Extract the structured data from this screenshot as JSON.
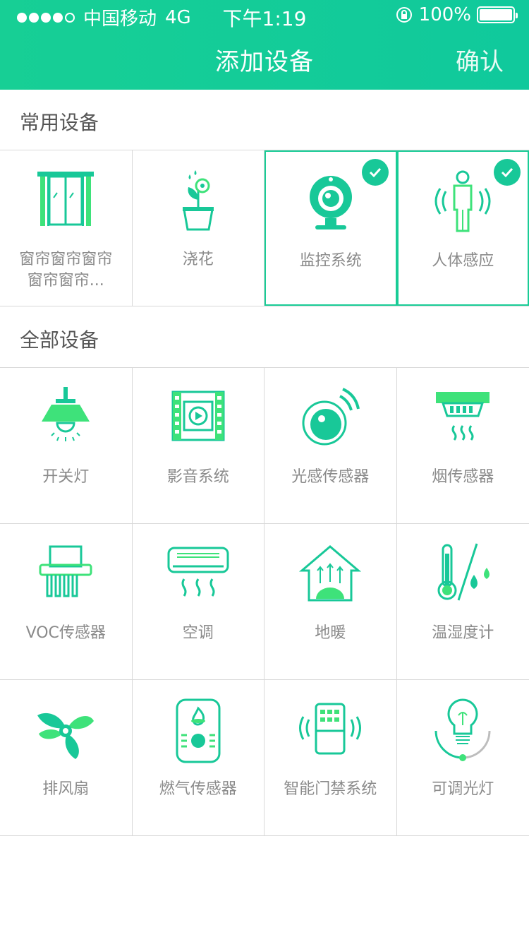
{
  "status_bar": {
    "carrier": "中国移动",
    "network": "4G",
    "time": "下午1:19",
    "battery": "100%"
  },
  "nav": {
    "title": "添加设备",
    "confirm_label": "确认"
  },
  "sections": {
    "common_title": "常用设备",
    "all_title": "全部设备"
  },
  "common_devices": [
    {
      "label": "窗帘窗帘窗帘\n窗帘窗帘...",
      "icon": "curtain-icon",
      "selected": false
    },
    {
      "label": "浇花",
      "icon": "flower-pot-icon",
      "selected": false
    },
    {
      "label": "监控系统",
      "icon": "webcam-icon",
      "selected": true
    },
    {
      "label": "人体感应",
      "icon": "motion-sensor-icon",
      "selected": true
    }
  ],
  "all_devices": [
    {
      "label": "开关灯",
      "icon": "pendant-lamp-icon"
    },
    {
      "label": "影音系统",
      "icon": "film-play-icon"
    },
    {
      "label": "光感传感器",
      "icon": "light-sensor-icon"
    },
    {
      "label": "烟传感器",
      "icon": "smoke-detector-icon"
    },
    {
      "label": "VOC传感器",
      "icon": "voc-sensor-icon"
    },
    {
      "label": "空调",
      "icon": "air-conditioner-icon"
    },
    {
      "label": "地暖",
      "icon": "floor-heating-icon"
    },
    {
      "label": "温湿度计",
      "icon": "thermo-hygrometer-icon"
    },
    {
      "label": "排风扇",
      "icon": "exhaust-fan-icon"
    },
    {
      "label": "燃气传感器",
      "icon": "gas-sensor-icon"
    },
    {
      "label": "智能门禁系统",
      "icon": "access-control-icon"
    },
    {
      "label": "可调光灯",
      "icon": "dimmable-bulb-icon"
    }
  ],
  "colors": {
    "brand": "#16cc96",
    "brand_light": "#3ee27a",
    "divider": "#d8d8d8",
    "label": "#8a8a8a"
  }
}
